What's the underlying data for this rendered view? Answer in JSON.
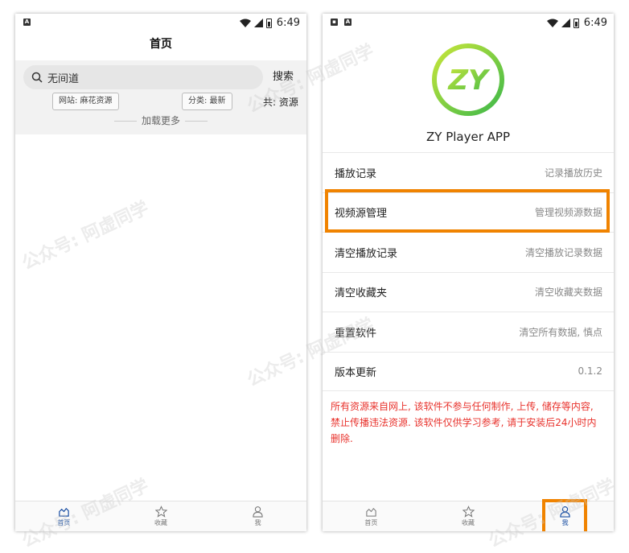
{
  "status": {
    "time": "6:49"
  },
  "left": {
    "title": "首页",
    "search": {
      "value": "无间道",
      "button": "搜索"
    },
    "filters": {
      "site": "网站: 麻花资源",
      "category": "分类: 最新"
    },
    "total": "共: 资源",
    "load_more": "加载更多",
    "tabs": [
      {
        "label": "首页",
        "icon": "home-icon",
        "active": true
      },
      {
        "label": "收藏",
        "icon": "star-icon",
        "active": false
      },
      {
        "label": "我",
        "icon": "user-icon",
        "active": false
      }
    ]
  },
  "right": {
    "app_name": "ZY Player APP",
    "logo": {
      "text": "ZY",
      "colors": {
        "outer": "#a8d83a",
        "inner": "#6dc23a"
      }
    },
    "menu": [
      {
        "label": "播放记录",
        "desc": "记录播放历史"
      },
      {
        "label": "视频源管理",
        "desc": "管理视频源数据"
      },
      {
        "label": "清空播放记录",
        "desc": "清空播放记录数据"
      },
      {
        "label": "清空收藏夹",
        "desc": "清空收藏夹数据"
      },
      {
        "label": "重置软件",
        "desc": "清空所有数据, 慎点"
      },
      {
        "label": "版本更新",
        "desc": "0.1.2"
      }
    ],
    "notice": "所有资源来自网上, 该软件不参与任何制作, 上传, 储存等内容, 禁止传播违法资源. 该软件仅供学习参考, 请于安装后24小时内删除.",
    "tabs": [
      {
        "label": "首页",
        "icon": "home-icon",
        "active": false
      },
      {
        "label": "收藏",
        "icon": "star-icon",
        "active": false
      },
      {
        "label": "我",
        "icon": "user-icon",
        "active": true
      }
    ]
  },
  "colors": {
    "highlight": "#f08300",
    "notice": "#e8322c",
    "active_tab": "#1a4fa3"
  },
  "watermark": "公众号: 阿虚同学"
}
